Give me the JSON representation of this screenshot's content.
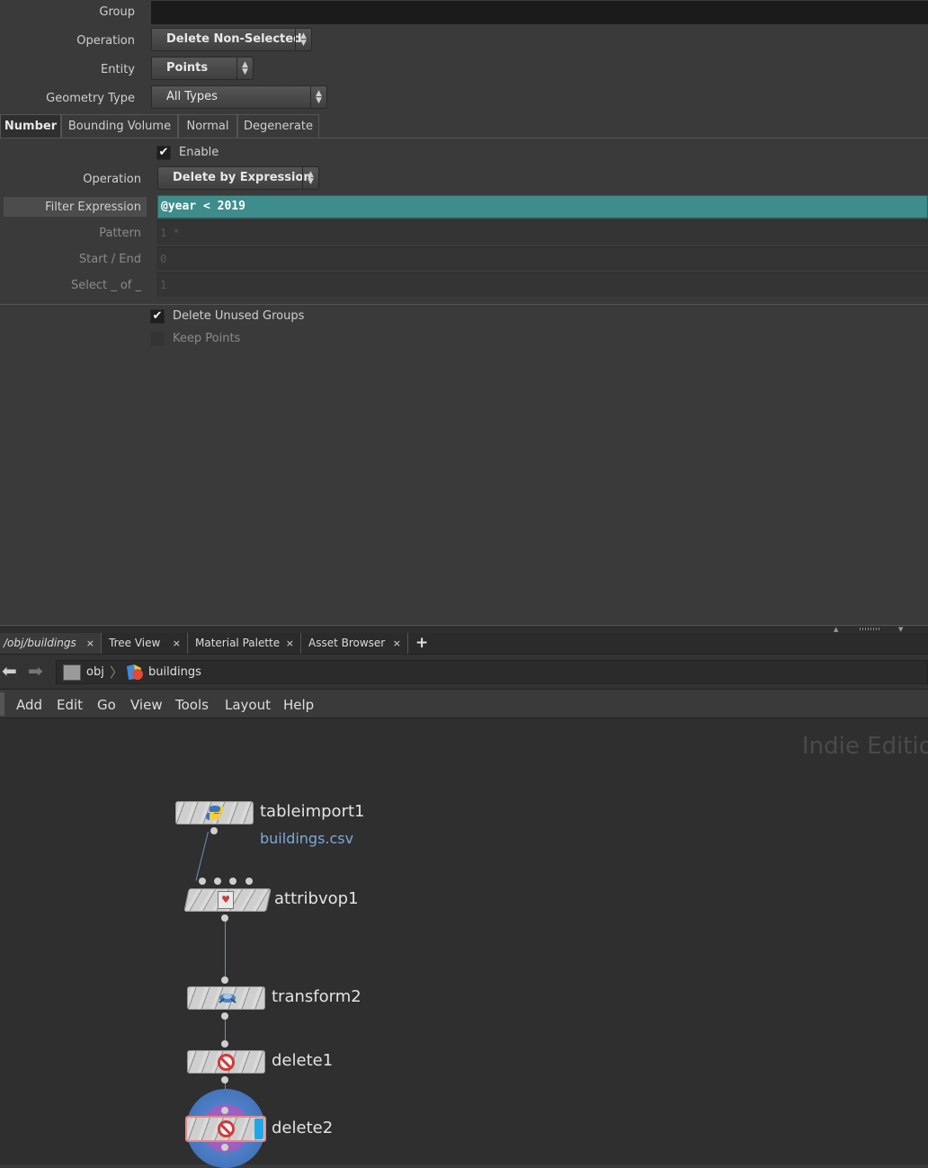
{
  "params": {
    "group": {
      "label": "Group",
      "value": ""
    },
    "operation": {
      "label": "Operation",
      "value": "Delete Non-Selected"
    },
    "entity": {
      "label": "Entity",
      "value": "Points"
    },
    "geometry_type": {
      "label": "Geometry Type",
      "value": "All Types"
    },
    "tabs": [
      "Number",
      "Bounding Volume",
      "Normal",
      "Degenerate"
    ],
    "enable_label": "Enable",
    "number_operation": {
      "label": "Operation",
      "value": "Delete by Expression"
    },
    "filter_expression": {
      "label": "Filter Expression",
      "value": "@year < 2019"
    },
    "pattern": {
      "label": "Pattern",
      "value": "1 *"
    },
    "start_end": {
      "label": "Start / End",
      "value": "0"
    },
    "select_of": {
      "label": "Select _ of _",
      "value": "1"
    },
    "delete_unused_groups": "Delete Unused Groups",
    "keep_points": "Keep Points"
  },
  "network": {
    "tabs": [
      "/obj/buildings",
      "Tree View",
      "Material Palette",
      "Asset Browser"
    ],
    "add_tab": "+",
    "breadcrumb": [
      "obj",
      "buildings"
    ],
    "menu": [
      "Add",
      "Edit",
      "Go",
      "View",
      "Tools",
      "Layout",
      "Help"
    ],
    "watermark": "Indie Edition",
    "nodes": [
      {
        "name": "tableimport1",
        "subtitle": "buildings.csv",
        "icon": "python-icon"
      },
      {
        "name": "attribvop1",
        "icon": "vop-icon"
      },
      {
        "name": "transform2",
        "icon": "transform-icon"
      },
      {
        "name": "delete1",
        "icon": "delete-icon"
      },
      {
        "name": "delete2",
        "icon": "delete-icon"
      }
    ]
  },
  "colors": {
    "accent": "#3e8c8c",
    "display_flag": "#1ea8e8",
    "link": "#7fa7dc"
  }
}
